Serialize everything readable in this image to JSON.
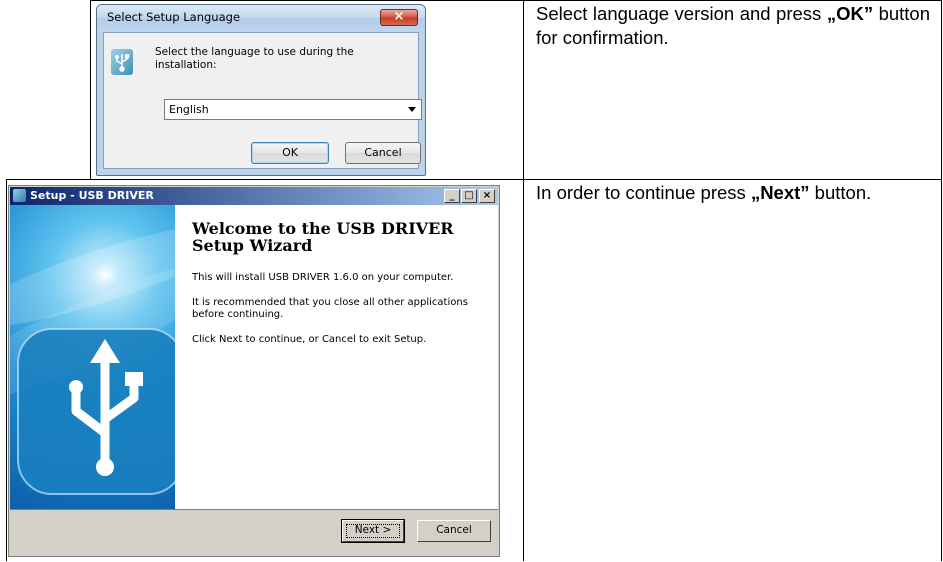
{
  "rows": [
    {
      "instruction": {
        "before": "Select language version and press ",
        "bold": "„OK”",
        "after": " button for confirmation."
      }
    },
    {
      "instruction": {
        "before": "In order to continue press ",
        "bold": "„Next”",
        "after": " button."
      }
    }
  ],
  "language_dialog": {
    "title": "Select Setup Language",
    "close_symbol": "×",
    "prompt": "Select the language to use during the installation:",
    "selected_language": "English",
    "ok_label": "OK",
    "cancel_label": "Cancel",
    "icon": "usb-icon"
  },
  "wizard": {
    "title": "Setup - USB DRIVER",
    "heading": "Welcome to the USB DRIVER Setup Wizard",
    "paragraphs": [
      "This will install USB DRIVER 1.6.0 on your computer.",
      "It is recommended that you close all other applications before continuing.",
      "Click Next to continue, or Cancel to exit Setup."
    ],
    "next_label": "Next >",
    "cancel_label": "Cancel",
    "window_controls": {
      "minimize": "_",
      "maximize": "□",
      "close": "×"
    },
    "side_icon": "usb-icon"
  }
}
